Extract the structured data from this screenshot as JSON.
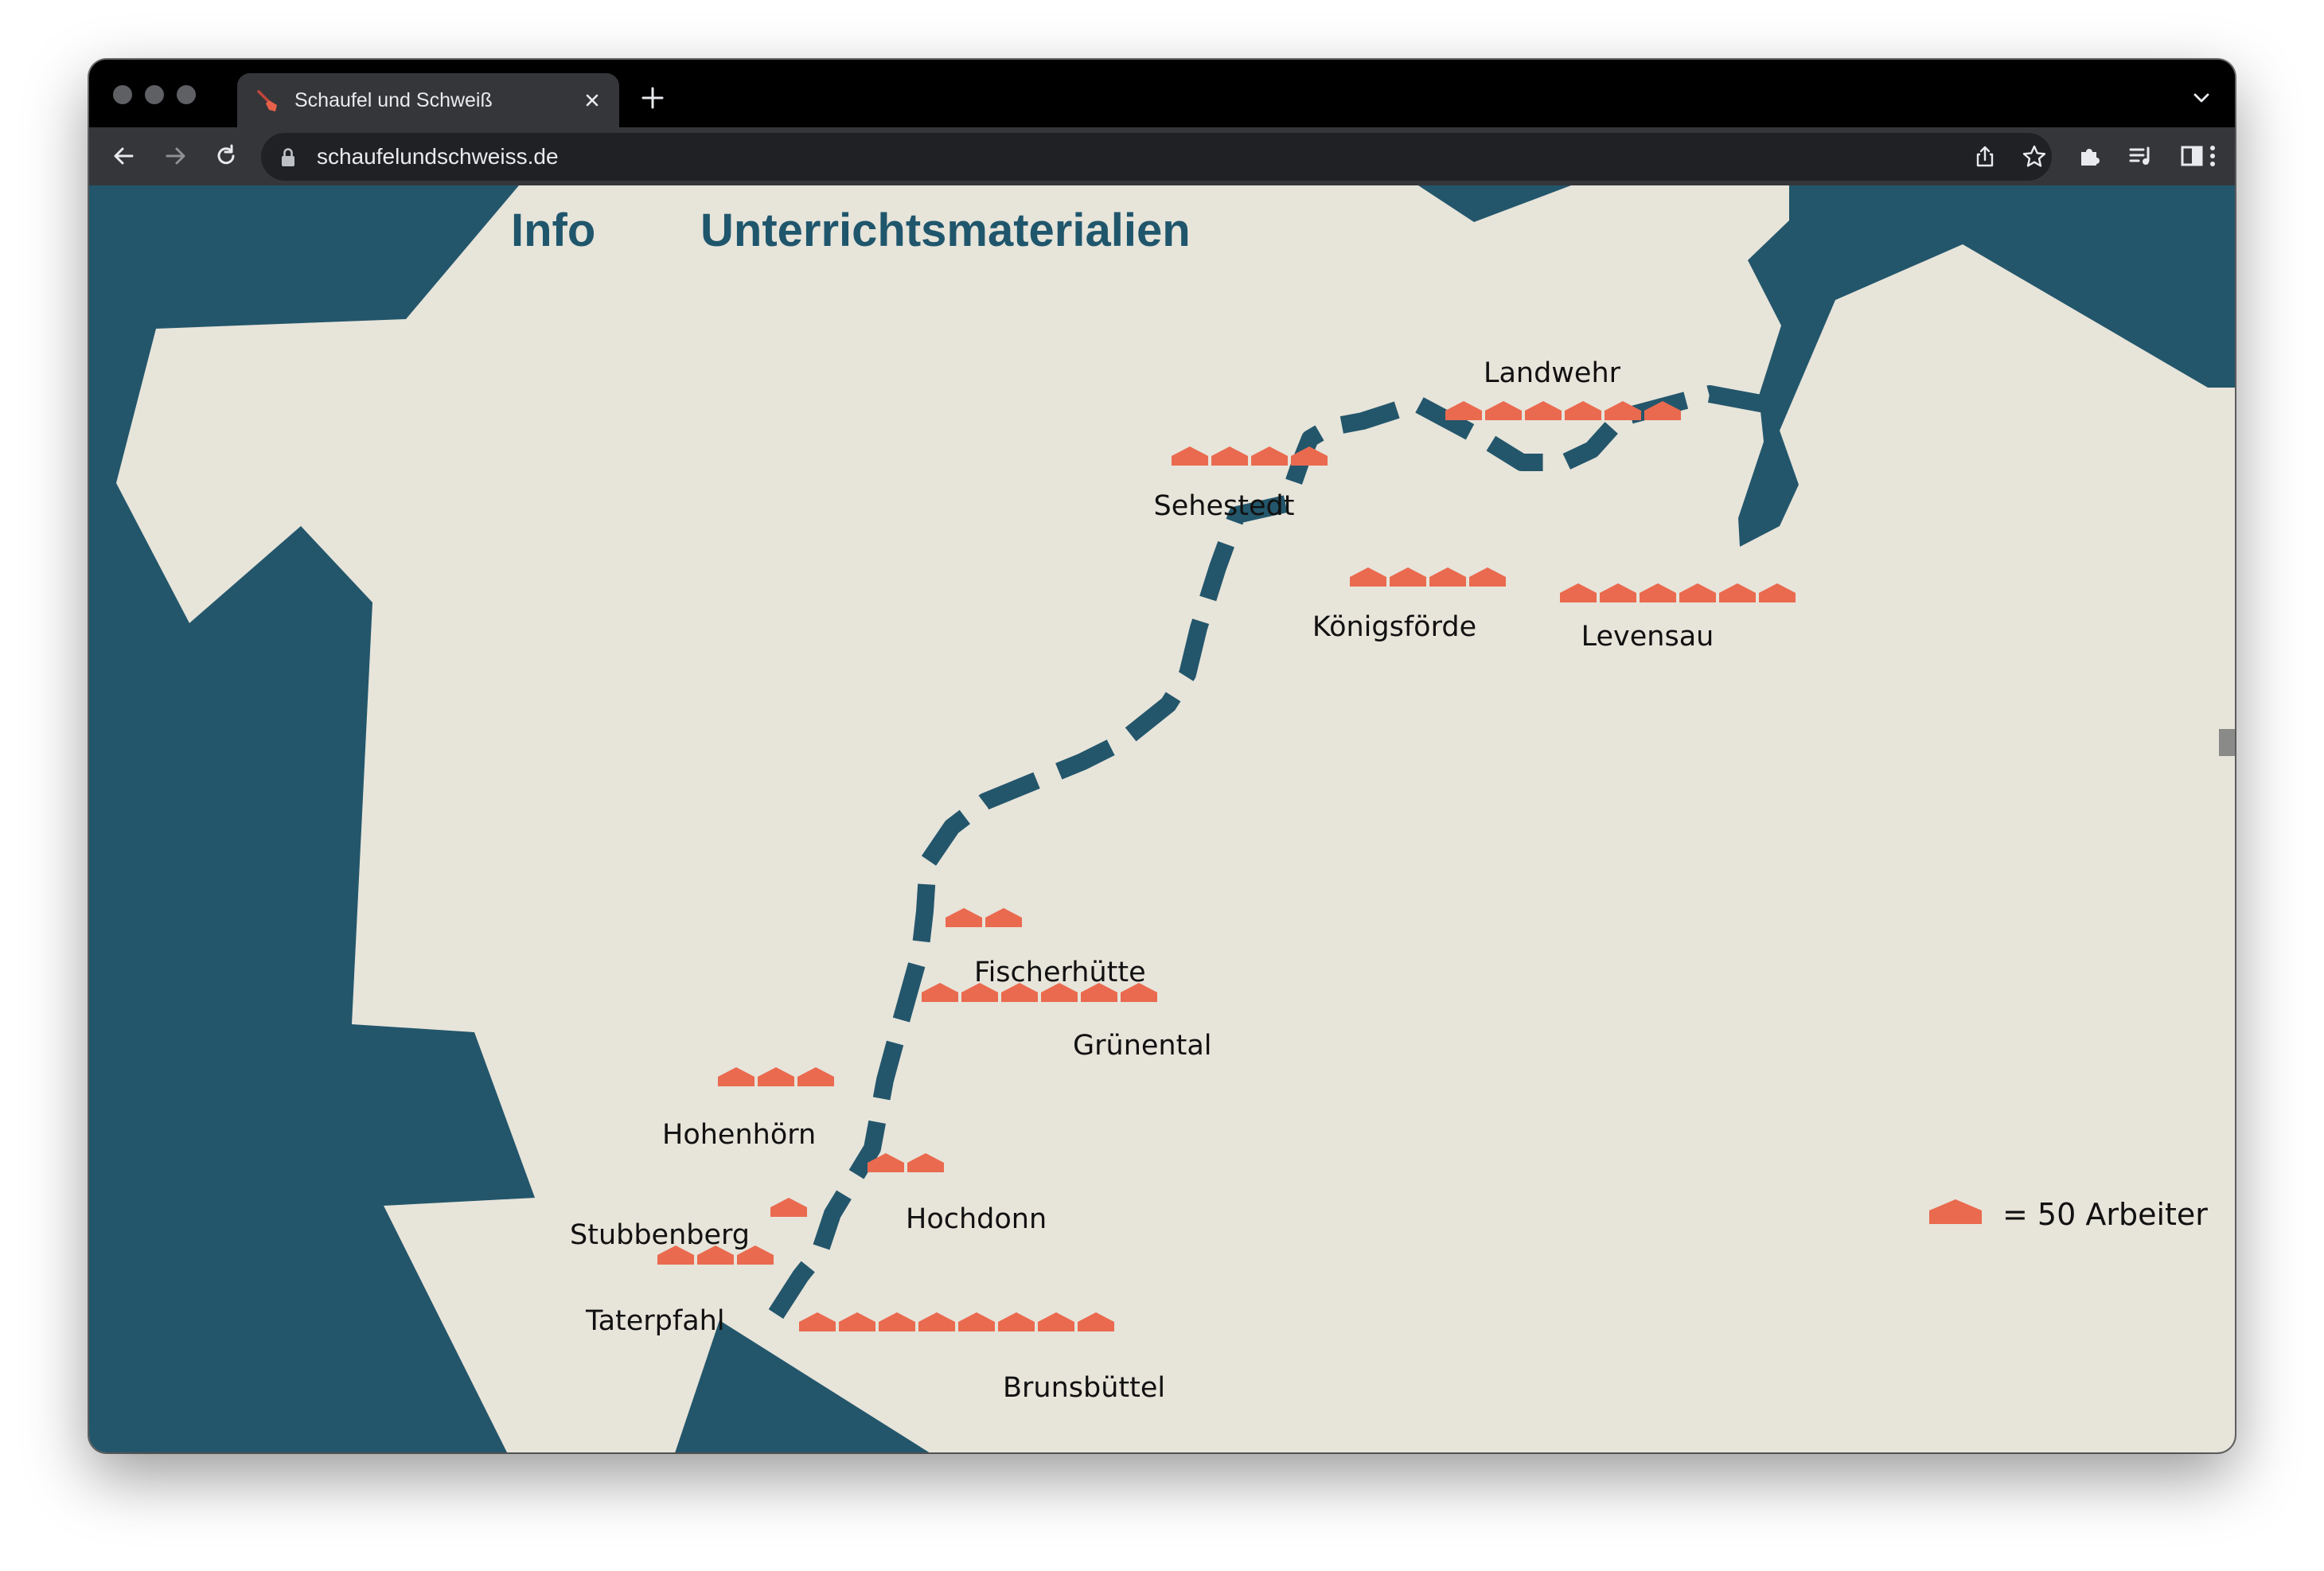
{
  "browser": {
    "tab": {
      "title": "Schaufel und Schweiß",
      "favicon": "shovel-icon"
    },
    "address_bar": {
      "url": "schaufelundschweiss.de"
    },
    "toolbar_icons": [
      "back-icon",
      "forward-icon",
      "reload-icon",
      "lock-icon",
      "share-icon",
      "bookmark-star-icon",
      "extensions-icon",
      "reading-list-icon",
      "side-panel-icon",
      "menu-icon"
    ]
  },
  "nav": {
    "items": [
      {
        "label": "Info"
      },
      {
        "label": "Unterrichtsmaterialien"
      }
    ]
  },
  "map": {
    "places": [
      {
        "name": "Landwehr",
        "houses": 6
      },
      {
        "name": "Sehestedt",
        "houses": 4
      },
      {
        "name": "Königsförde",
        "houses": 4
      },
      {
        "name": "Levensau",
        "houses": 6
      },
      {
        "name": "Fischerhütte",
        "houses": 2
      },
      {
        "name": "Grünental",
        "houses": 6
      },
      {
        "name": "Hohenhörn",
        "houses": 3
      },
      {
        "name": "Hochdonn",
        "houses": 2
      },
      {
        "name": "Stubbenberg",
        "houses": 1
      },
      {
        "name": "Taterpfahl",
        "houses": 3
      },
      {
        "name": "Brunsbüttel",
        "houses": 8
      }
    ],
    "legend": {
      "label": "= 50 Arbeiter",
      "workers_per_house": 50
    }
  },
  "colors": {
    "land": "#e7e4da",
    "water": "#23566b",
    "house": "#ea6a4f",
    "nav_text": "#1f566c"
  }
}
